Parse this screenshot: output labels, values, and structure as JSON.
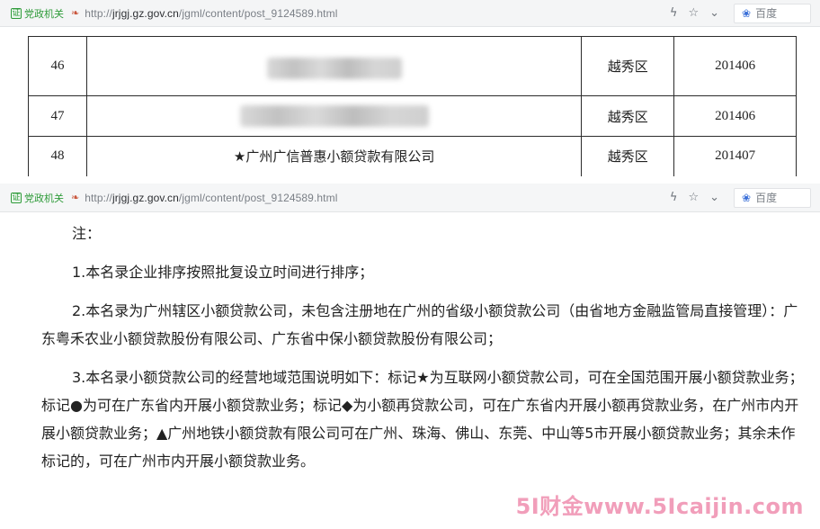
{
  "browser": {
    "badge_label": "党政机关",
    "url_prefix": "http://",
    "url_domain": "jrjgj.gz.gov.cn",
    "url_path": "/jgml/content/post_9124589.html",
    "search_label": "百度",
    "icons": [
      "lightning-icon",
      "star-icon",
      "chevron-down-icon",
      "baidu-paw-icon"
    ]
  },
  "table": {
    "rows": [
      {
        "num": "46",
        "name": "",
        "district": "越秀区",
        "date": "201406",
        "name_redacted": true
      },
      {
        "num": "47",
        "name": "",
        "district": "越秀区",
        "date": "201406",
        "name_redacted": true
      },
      {
        "num": "48",
        "name": "★广州广信普惠小额贷款有限公司",
        "district": "越秀区",
        "date": "201407",
        "name_redacted": false
      }
    ]
  },
  "notes": {
    "heading": "注：",
    "items": [
      "1.本名录企业排序按照批复设立时间进行排序；",
      "2.本名录为广州辖区小额贷款公司，未包含注册地在广州的省级小额贷款公司（由省地方金融监管局直接管理）：广东粤禾农业小额贷款股份有限公司、广东省中保小额贷款股份有限公司；",
      "3.本名录小额贷款公司的经营地域范围说明如下：标记★为互联网小额贷款公司，可在全国范围开展小额贷款业务；标记●为可在广东省内开展小额贷款业务；标记◆为小额再贷款公司，可在广东省内开展小额再贷款业务，在广州市内开展小额贷款业务；▲广州地铁小额贷款有限公司可在广州、珠海、佛山、东莞、中山等5市开展小额贷款业务；其余未作标记的，可在广州市内开展小额贷款业务。"
    ]
  },
  "watermark": "5I财金www.5Icaijin.com",
  "colors": {
    "badge_green": "#2f9b3a",
    "watermark_pink": "#ec78a0",
    "table_border": "#2b2b2b",
    "addrbar_bg": "#f4f5f6"
  }
}
